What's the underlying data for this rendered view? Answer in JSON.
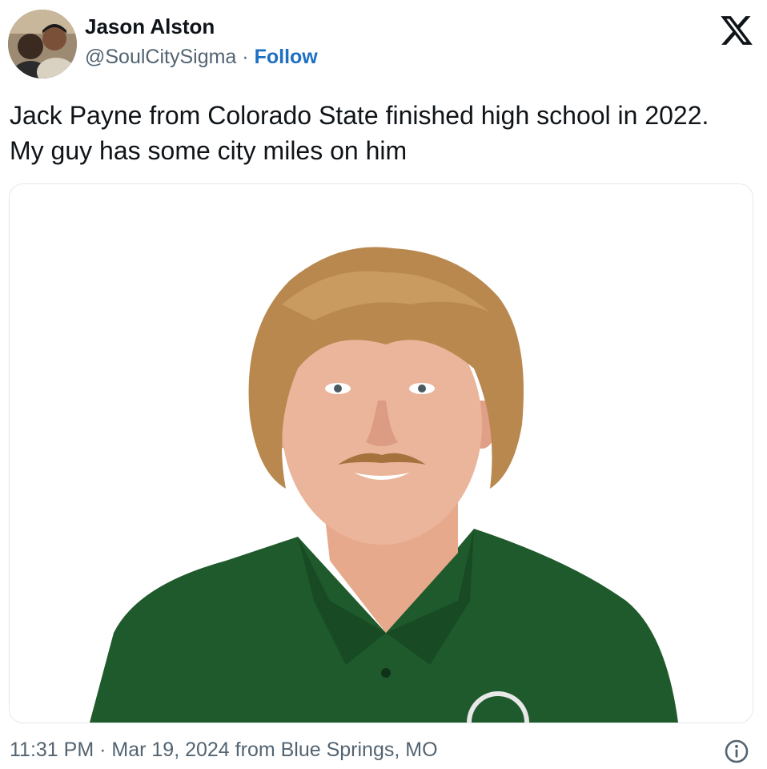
{
  "tweet": {
    "author": {
      "display_name": "Jason Alston",
      "handle": "@SoulCitySigma",
      "separator": "·",
      "follow_label": "Follow",
      "avatar": "profile-photo-of-two-people"
    },
    "platform_icon": "x-logo-icon",
    "text": "Jack Payne from Colorado State finished high school in 2022. My guy has some city miles on him",
    "media": {
      "type": "photo",
      "subject": "portrait-young-man-green-polo"
    },
    "timestamp": {
      "time": "11:31 PM",
      "separator": "·",
      "date": "Mar 19, 2024",
      "location_text": "from Blue Springs, MO"
    },
    "info_icon": "info-icon"
  },
  "colors": {
    "link": "#1d6fc2",
    "secondary_text": "#536471",
    "primary_text": "#0f1419",
    "card_border": "#e3e7ea",
    "shirt_green": "#1f5a2c",
    "hair": "#b8884e"
  }
}
